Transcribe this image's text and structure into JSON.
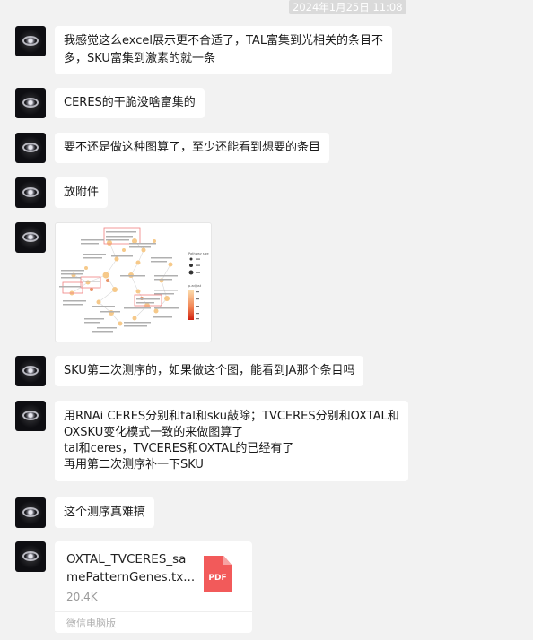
{
  "timestamp": "2024年1月25日 11:08",
  "messages": [
    {
      "lines": [
        "我感觉这么excel展示更不合适了，TAL富集到光相关的条目不",
        "多，SKU富集到激素的就一条"
      ]
    },
    {
      "lines": [
        "CERES的干脆没啥富集的"
      ]
    },
    {
      "lines": [
        "要不还是做这种图算了，至少还能看到想要的条目"
      ]
    },
    {
      "lines": [
        "放附件"
      ]
    },
    {
      "lines": [
        "SKU第二次测序的，如果做这个图，能看到JA那个条目吗"
      ]
    },
    {
      "lines": [
        "用RNAi CERES分别和tal和sku敲除；TVCERES分别和OXTAL和",
        "OXSKU变化模式一致的来做图算了",
        "tal和ceres，TVCERES和OXTAL的已经有了",
        "再用第二次测序补一下SKU"
      ]
    },
    {
      "lines": [
        "这个测序真难搞"
      ]
    }
  ],
  "image_message": {
    "legend_title_1": "Pathway size",
    "legend_title_2": "p.adjust"
  },
  "file_message": {
    "file_name": "OXTAL_TVCERES_samePatternGenes.tx...",
    "file_name_line1": "OXTAL_TVCERES_sa",
    "file_name_line2": "mePatternGenes.tx...",
    "file_size": "20.4K",
    "file_type_label": "PDF",
    "source": "微信电脑版",
    "icon_color": "#f25a5a"
  },
  "colors": {
    "background": "#f2f2f2",
    "bubble": "#ffffff",
    "timestamp_bg": "#dadada"
  },
  "avatar_icon": "saturn-avatar-icon"
}
